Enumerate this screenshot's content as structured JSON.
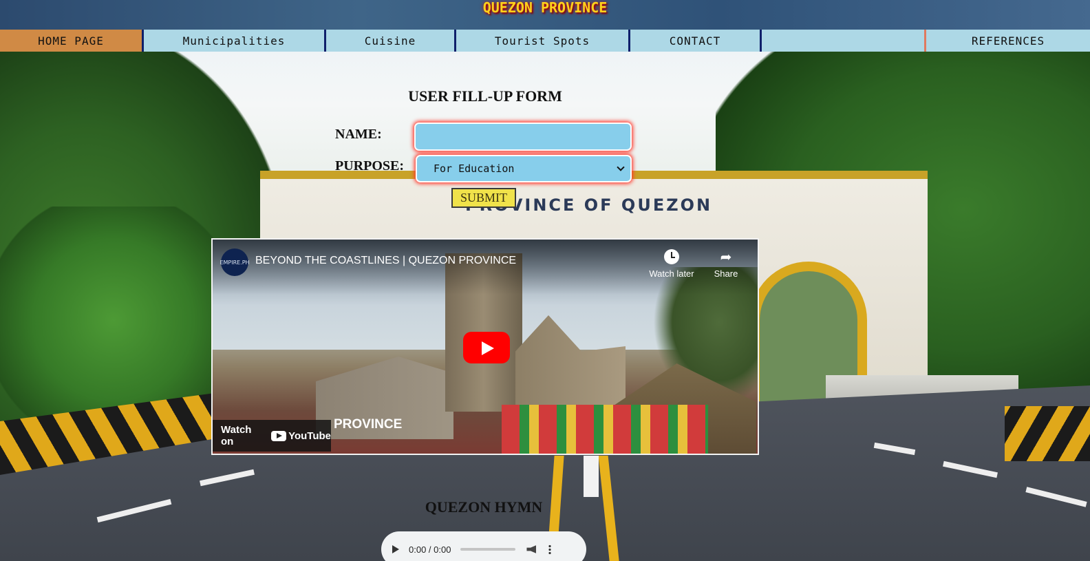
{
  "site": {
    "title": "QUEZON PROVINCE"
  },
  "nav": {
    "items": [
      {
        "label": "HOME PAGE"
      },
      {
        "label": "Municipalities"
      },
      {
        "label": "Cuisine"
      },
      {
        "label": "Tourist Spots"
      },
      {
        "label": "CONTACT"
      },
      {
        "label": ""
      },
      {
        "label": "REFERENCES"
      }
    ],
    "active_color": "#d08a45",
    "item_color": "#add8e6"
  },
  "background": {
    "arch_text": "PROVINCE OF QUEZON"
  },
  "form": {
    "title": "USER FILL-UP FORM",
    "name_label": "NAME:",
    "name_value": "",
    "purpose_label": "PURPOSE:",
    "purpose_selected": "For Education",
    "submit_label": "SUBMIT"
  },
  "video": {
    "channel_logo_text": "EMPIRE.PH",
    "title": "BEYOND THE COASTLINES | QUEZON PROVINCE",
    "watch_later_label": "Watch later",
    "share_label": "Share",
    "watch_on_label": "Watch on",
    "youtube_label": "YouTube",
    "overlay_text": "PROVINCE",
    "play_button_color": "#ff0000"
  },
  "hymn": {
    "title": "QUEZON HYMN",
    "time": "0:00 / 0:00"
  }
}
